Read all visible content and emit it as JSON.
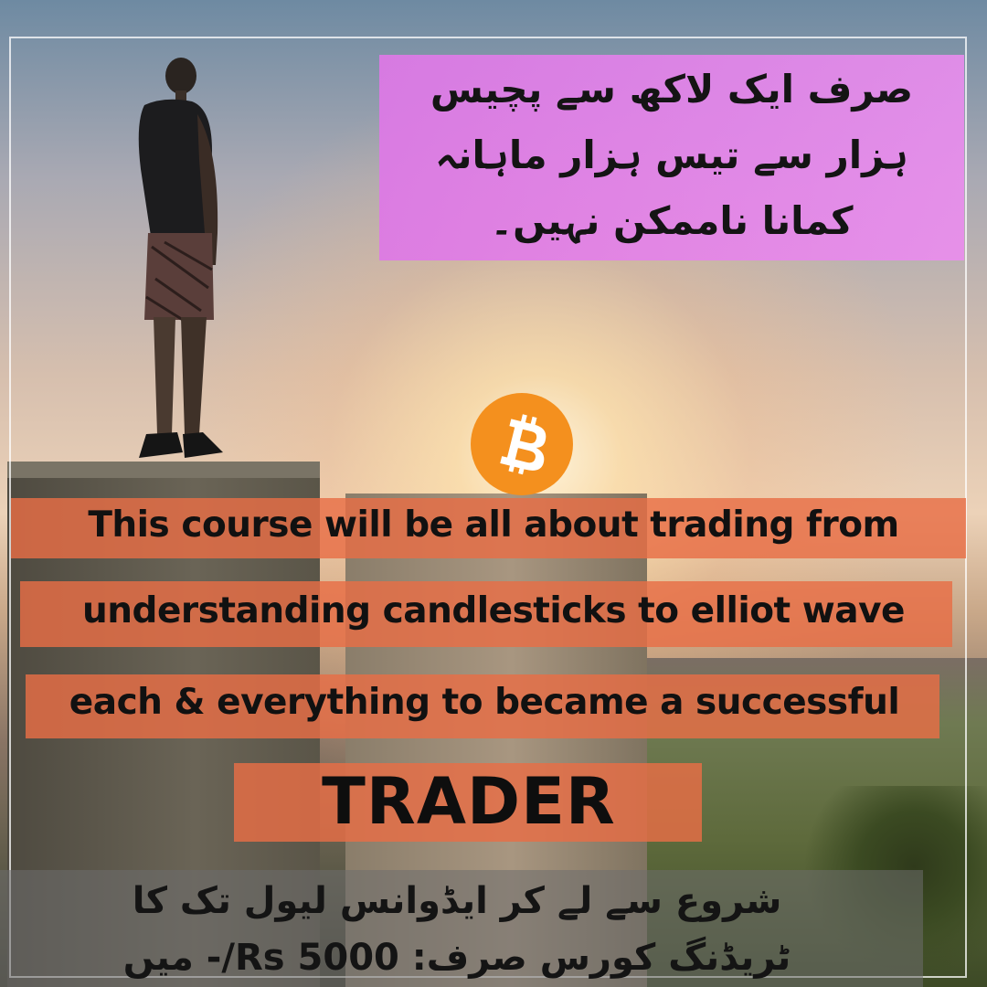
{
  "urdu_headline": {
    "line1": "صرف ایک لاکھ سے پچیس",
    "line2": "ہزار سے تیس ہزار ماہانہ",
    "line3": "کمانا ناممکن نہیں۔"
  },
  "coin": {
    "icon": "bitcoin-icon",
    "color": "#f4901e"
  },
  "english_lines": [
    "This course will be all about trading from",
    "understanding candlesticks to elliot wave",
    "each & everything to became a successful"
  ],
  "trader": "TRADER",
  "bottom": {
    "line1": "شروع سے لے کر ایڈوانس لیول تک کا",
    "line2": "ٹریڈنگ کورس صرف: Rs 5000/- میں"
  },
  "colors": {
    "highlight_pink": "#e07ae8",
    "highlight_orange": "#e86e46",
    "bitcoin_orange": "#f4901e"
  }
}
